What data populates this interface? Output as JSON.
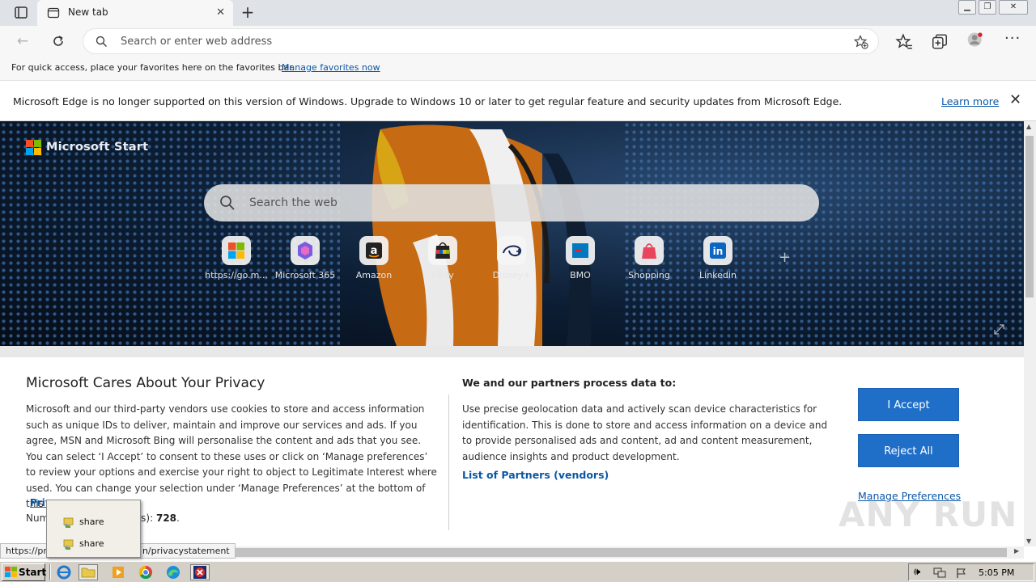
{
  "browser": {
    "tab_title": "New tab",
    "address_placeholder": "Search or enter web address",
    "favorites_hint": "For quick access, place your favorites here on the favorites bar.",
    "favorites_link": "Manage favorites now"
  },
  "infobar": {
    "message": "Microsoft Edge is no longer supported on this version of Windows. Upgrade to Windows 10 or later to get regular feature and security updates from Microsoft Edge.",
    "link": "Learn more"
  },
  "newtab": {
    "brand": "Microsoft Start",
    "search_placeholder": "Search the web",
    "sites": [
      {
        "label": "https://go.m...",
        "icon": "microsoft-icon"
      },
      {
        "label": "Microsoft 365",
        "icon": "microsoft-365-icon"
      },
      {
        "label": "Amazon",
        "icon": "amazon-icon"
      },
      {
        "label": "eBay",
        "icon": "ebay-icon"
      },
      {
        "label": "Disney+",
        "icon": "disney-plus-icon"
      },
      {
        "label": "BMO",
        "icon": "bmo-icon"
      },
      {
        "label": "Shopping",
        "icon": "shopping-bag-icon"
      },
      {
        "label": "Linkedin",
        "icon": "linkedin-icon"
      }
    ]
  },
  "privacy": {
    "title": "Microsoft Cares About Your Privacy",
    "body": "Microsoft and our third-party vendors use cookies to store and access information such as unique IDs to deliver, maintain and improve our services and ads. If you agree, MSN and Microsoft Bing will personalise the content and ads that you see. You can select ‘I Accept’ to consent to these uses or click on ‘Manage preferences’ to review your options and exercise your right to object to Legitimate Interest where used.  You can change your selection under ‘Manage Preferences’ at the bottom of this page.",
    "policy_link_visible": "Priv",
    "vendors_prefix_visible": "Num",
    "vendors_suffix_visible": "dors): ",
    "vendors_count": "728",
    "vendors_end": ".",
    "subtitle": "We and our partners process data to:",
    "purposes": "Use precise geolocation data and actively scan device characteristics for identification. This is done to store and access information on a device and to provide personalised ads and content, ad and content measurement, audience insights and product development.",
    "partners_link": "List of Partners (vendors)",
    "accept": "I Accept",
    "reject": "Reject All",
    "manage": "Manage Preferences"
  },
  "status": {
    "url_start": "https://pr",
    "url_end": "n/privacystatement"
  },
  "popup": {
    "items": [
      "share",
      "share"
    ]
  },
  "taskbar": {
    "start": "Start",
    "clock": "5:05 PM"
  },
  "watermark": "ANY RUN",
  "colors": {
    "accent_blue": "#1f6fc9",
    "link_blue": "#0b57a6",
    "taskbar_gray": "#d4d0c8"
  }
}
